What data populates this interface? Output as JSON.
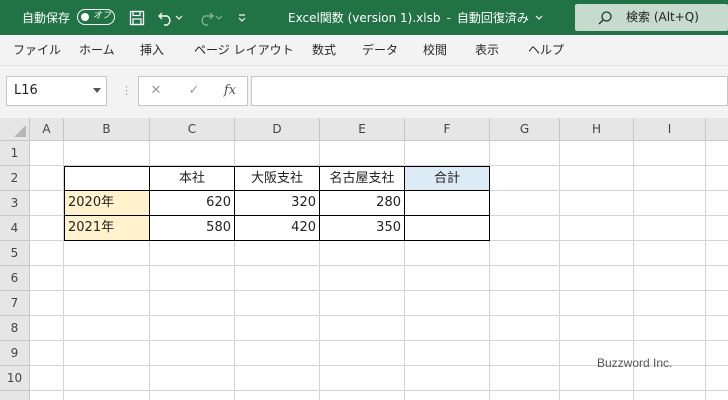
{
  "titlebar": {
    "autosave_label": "自動保存",
    "autosave_state": "オフ",
    "file_name": "Excel関数 (version 1).xlsb",
    "save_state": "自動回復済み",
    "search_label": "検索 (Alt+Q)",
    "icons": [
      "save-icon",
      "undo-icon",
      "redo-icon",
      "customize-icon",
      "search-icon"
    ],
    "bg_color": "#217346"
  },
  "menu": {
    "items": [
      "ファイル",
      "ホーム",
      "挿入",
      "ページ レイアウト",
      "数式",
      "データ",
      "校閲",
      "表示",
      "ヘルプ"
    ]
  },
  "formula_bar": {
    "name_box": "L16",
    "cancel_label": "✕",
    "enter_label": "✓",
    "fx_label": "fx",
    "formula": ""
  },
  "sheet": {
    "columns": [
      "A",
      "B",
      "C",
      "D",
      "E",
      "F",
      "G",
      "H",
      "I"
    ],
    "rows": [
      "1",
      "2",
      "3",
      "4",
      "5",
      "6",
      "7",
      "8",
      "9",
      "10"
    ],
    "table": {
      "headers": [
        "",
        "本社",
        "大阪支社",
        "名古屋支社",
        "合計"
      ],
      "rows": [
        {
          "label": "2020年",
          "values": [
            "620",
            "320",
            "280",
            ""
          ]
        },
        {
          "label": "2021年",
          "values": [
            "580",
            "420",
            "350",
            ""
          ]
        }
      ],
      "label_fill": "#fff2cc",
      "total_header_fill": "#ddebf7"
    }
  },
  "watermark": "Buzzword Inc."
}
